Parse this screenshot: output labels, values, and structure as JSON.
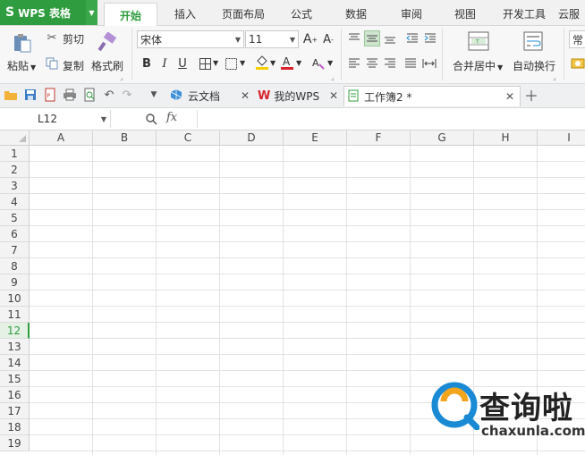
{
  "app": {
    "name": "WPS 表格",
    "logo": "S"
  },
  "tabs": [
    "开始",
    "插入",
    "页面布局",
    "公式",
    "数据",
    "审阅",
    "视图",
    "开发工具",
    "云服"
  ],
  "active_tab": "开始",
  "ribbon": {
    "paste": "粘贴",
    "cut": "剪切",
    "copy": "复制",
    "format_painter": "格式刷",
    "font_name": "宋体",
    "font_size": "11",
    "merge_center": "合并居中",
    "wrap_text": "自动换行",
    "number_format": "常"
  },
  "doc_tabs": [
    {
      "label": "云文档"
    },
    {
      "label": "我的WPS"
    },
    {
      "label": "工作簿2 *"
    }
  ],
  "formula_bar": {
    "cell_ref": "L12",
    "fx": "fx",
    "value": ""
  },
  "columns": [
    "A",
    "B",
    "C",
    "D",
    "E",
    "F",
    "G",
    "H",
    "I"
  ],
  "rows": [
    "1",
    "2",
    "3",
    "4",
    "5",
    "6",
    "7",
    "8",
    "9",
    "10",
    "11",
    "12",
    "13",
    "14",
    "15",
    "16",
    "17",
    "18",
    "19"
  ],
  "selected_row": "12",
  "colors": {
    "brand": "#2f9c3f",
    "accent_red": "#d9232c",
    "accent_blue": "#1a8ad4"
  },
  "watermark": {
    "cn": "查询啦",
    "domain": "chaxunla.com"
  }
}
